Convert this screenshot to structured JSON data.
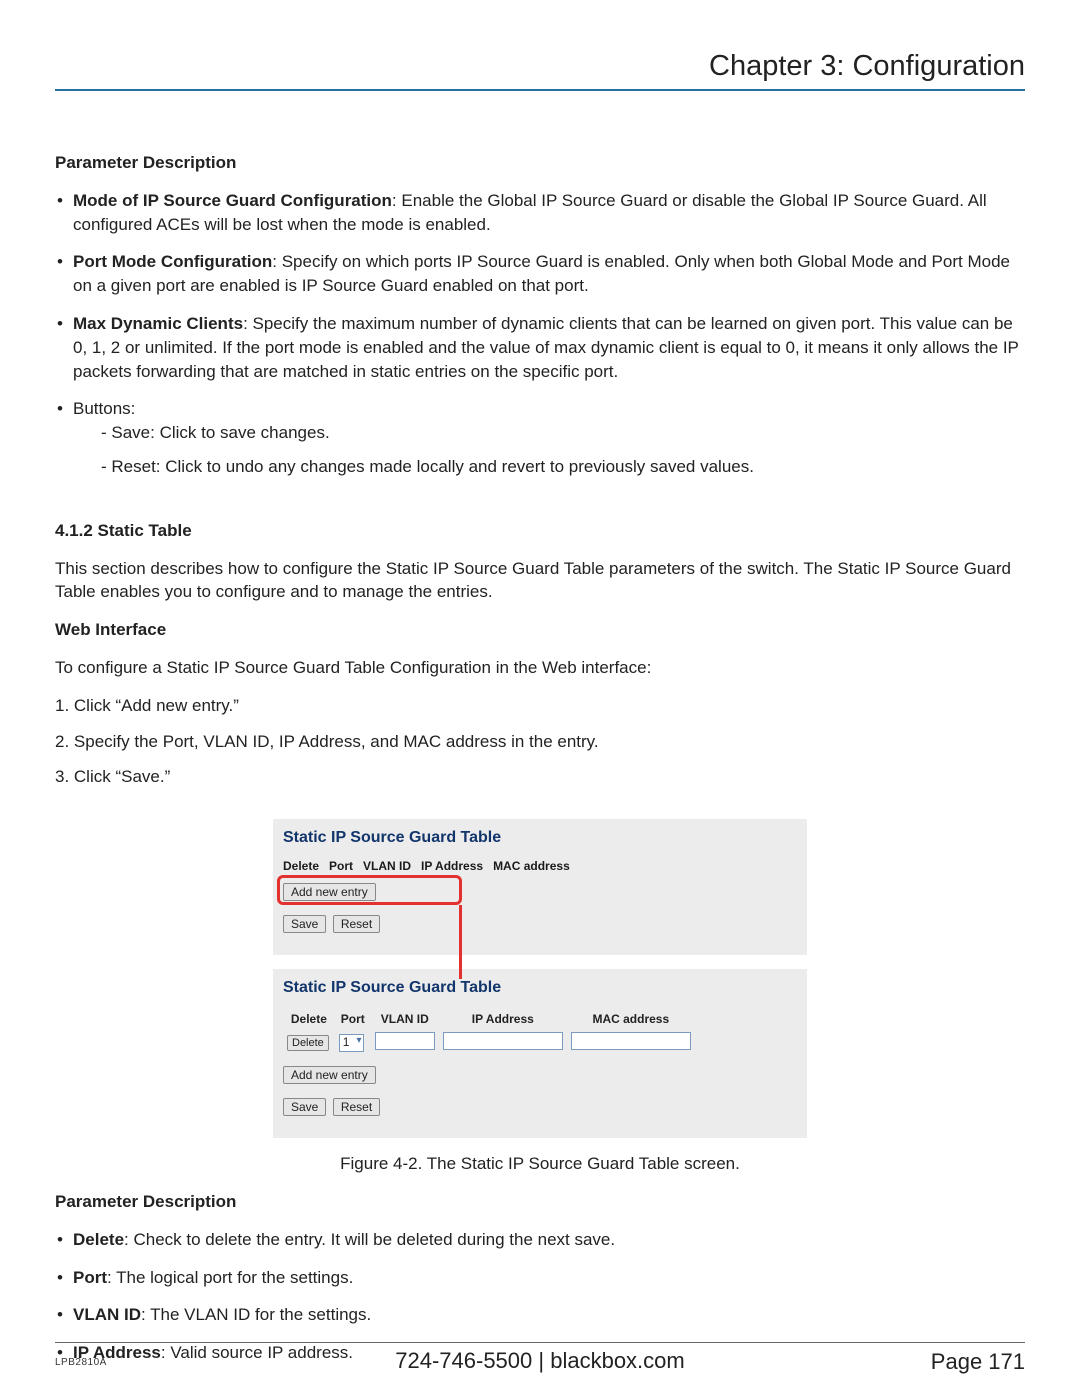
{
  "header": {
    "chapter_title": "Chapter 3: Configuration"
  },
  "sections": {
    "param_desc_heading_1": "Parameter Description",
    "b1_term": "Mode of IP Source Guard Configuration",
    "b1_text": ": Enable the Global IP Source Guard or disable the Global IP Source Guard. All configured ACEs will be lost when the mode is enabled.",
    "b2_term": "Port Mode Configuration",
    "b2_text": ": Specify on which ports IP Source Guard is enabled. Only when both Global Mode and Port Mode on a given port are enabled is IP Source Guard enabled on that port.",
    "b3_term": "Max Dynamic Clients",
    "b3_text": ": Specify the maximum number of dynamic clients that can be learned on given port. This value can be 0, 1, 2 or unlimited. If the port mode is enabled and the value of max dynamic client is equal to 0, it means it only allows the IP packets forwarding that are matched in static entries on the specific port.",
    "b4_text": "Buttons:",
    "b4_save": "- Save: Click to save changes.",
    "b4_reset": "- Reset: Click to undo any changes made locally and revert to previously saved values.",
    "static_table_heading": "4.1.2 Static Table",
    "static_table_intro": "This section describes how to configure the Static IP Source Guard Table parameters of the switch. The Static IP Source Guard Table enables you to configure and to manage the entries.",
    "web_interface_heading": "Web Interface",
    "web_interface_intro": "To configure a Static IP Source Guard Table Configuration in the Web interface:",
    "step1": "1. Click “Add new entry.”",
    "step2": "2. Specify the Port, VLAN ID, IP Address, and MAC address in the entry.",
    "step3": "3. Click “Save.”"
  },
  "fig": {
    "panel_title": "Static IP Source Guard Table",
    "h_delete": "Delete",
    "h_port": "Port",
    "h_vlanid": "VLAN ID",
    "h_ipaddr": "IP Address",
    "h_macaddr": "MAC address",
    "btn_add": "Add new entry",
    "btn_save": "Save",
    "btn_reset": "Reset",
    "btn_delete": "Delete",
    "port_value": "1",
    "caption": "Figure 4-2. The Static IP Source Guard Table screen."
  },
  "sections2": {
    "param_desc_heading_2": "Parameter Description",
    "pd_delete_term": "Delete",
    "pd_delete_text": ": Check to delete the entry. It will be deleted during the next save.",
    "pd_port_term": "Port",
    "pd_port_text": ": The logical port for the settings.",
    "pd_vlan_term": "VLAN ID",
    "pd_vlan_text": ": The VLAN ID for the settings.",
    "pd_ip_term": "IP Address",
    "pd_ip_text": ": Valid source IP address."
  },
  "footer": {
    "model": "LPB2810A",
    "phone": "724-746-5500",
    "sep": "   |   ",
    "site": "blackbox.com",
    "page_label": "Page 171"
  }
}
